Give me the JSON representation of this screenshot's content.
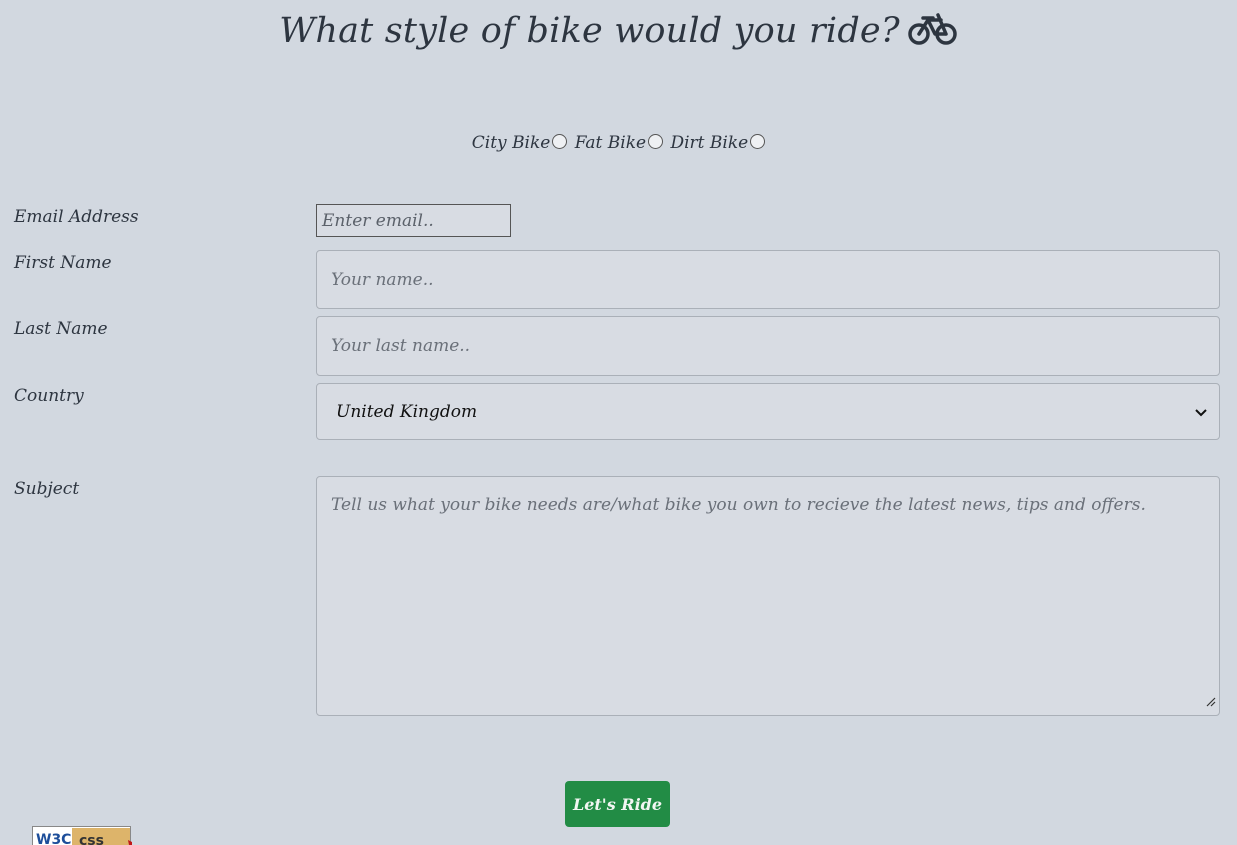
{
  "header": {
    "title": "What style of bike would you ride?",
    "icon": "bicycle-icon"
  },
  "bike_options": [
    {
      "label": "City Bike",
      "checked": false
    },
    {
      "label": "Fat Bike",
      "checked": false
    },
    {
      "label": "Dirt Bike",
      "checked": false
    }
  ],
  "form": {
    "email": {
      "label": "Email Address",
      "placeholder": "Enter email.."
    },
    "first_name": {
      "label": "First Name",
      "placeholder": "Your name.."
    },
    "last_name": {
      "label": "Last Name",
      "placeholder": "Your last name.."
    },
    "country": {
      "label": "Country",
      "value": "United Kingdom",
      "icon": "chevron-down-icon"
    },
    "subject": {
      "label": "Subject",
      "placeholder": "Tell us what your bike needs are/what bike you own to recieve the latest news, tips and offers."
    },
    "submit_label": "Let's Ride"
  },
  "footer": {
    "badge_text": "W3C css",
    "badge_icon": "w3c-css-badge"
  },
  "colors": {
    "background": "#d2d8e0",
    "text": "#2d3540",
    "input_bg": "#d8dce3",
    "submit_bg": "#228c45"
  }
}
